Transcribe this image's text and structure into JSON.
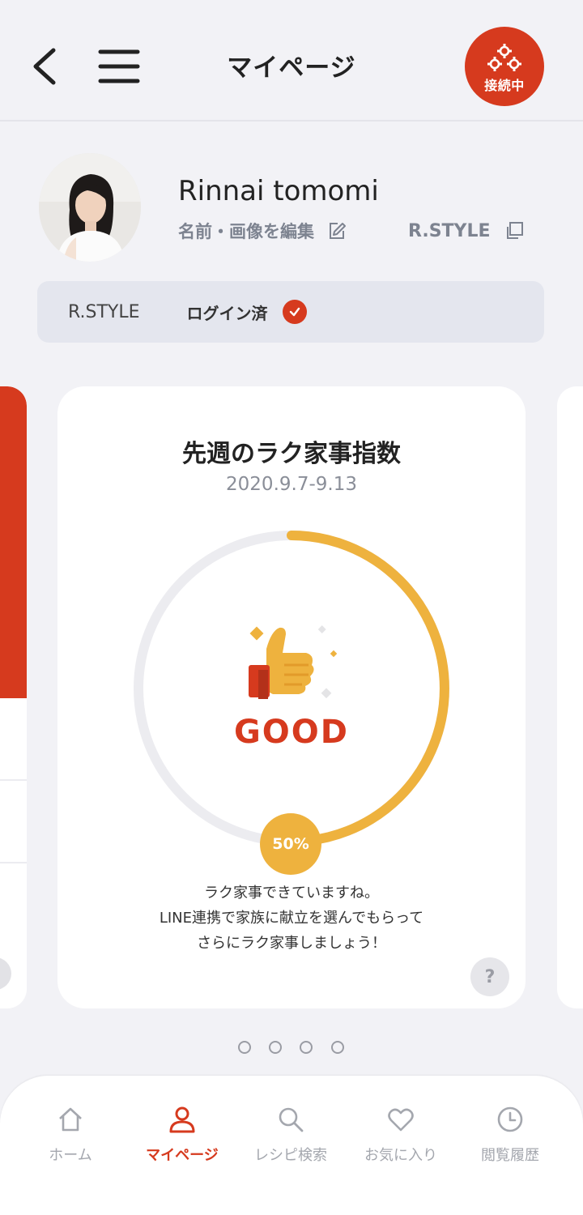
{
  "header": {
    "title": "マイページ",
    "connect_label": "接続中"
  },
  "profile": {
    "name": "Rinnai tomomi",
    "edit_label": "名前・画像を編集",
    "rstyle_link": "R.STYLE"
  },
  "login": {
    "service": "R.STYLE",
    "status": "ログイン済"
  },
  "card": {
    "title": "先週のラク家事指数",
    "date": "2020.9.7-9.13",
    "grade": "GOOD",
    "percent_label": "50%",
    "progress": 0.5,
    "message": [
      "ラク家事できていますね。",
      "LINE連携で家族に献立を選んでもらって",
      "さらにラク家事しましょう！"
    ],
    "help": "?"
  },
  "pager": {
    "count": 4,
    "active": 0
  },
  "nav": {
    "items": [
      {
        "label": "ホーム",
        "icon": "home-icon",
        "active": false
      },
      {
        "label": "マイページ",
        "icon": "person-icon",
        "active": true
      },
      {
        "label": "レシピ検索",
        "icon": "search-icon",
        "active": false
      },
      {
        "label": "お気に入り",
        "icon": "heart-icon",
        "active": false
      },
      {
        "label": "閲覧履歴",
        "icon": "clock-icon",
        "active": false
      }
    ]
  },
  "colors": {
    "accent": "#d63a1e",
    "gauge": "#eeb23e",
    "gauge_track": "#ececf0",
    "background": "#f2f2f6"
  }
}
